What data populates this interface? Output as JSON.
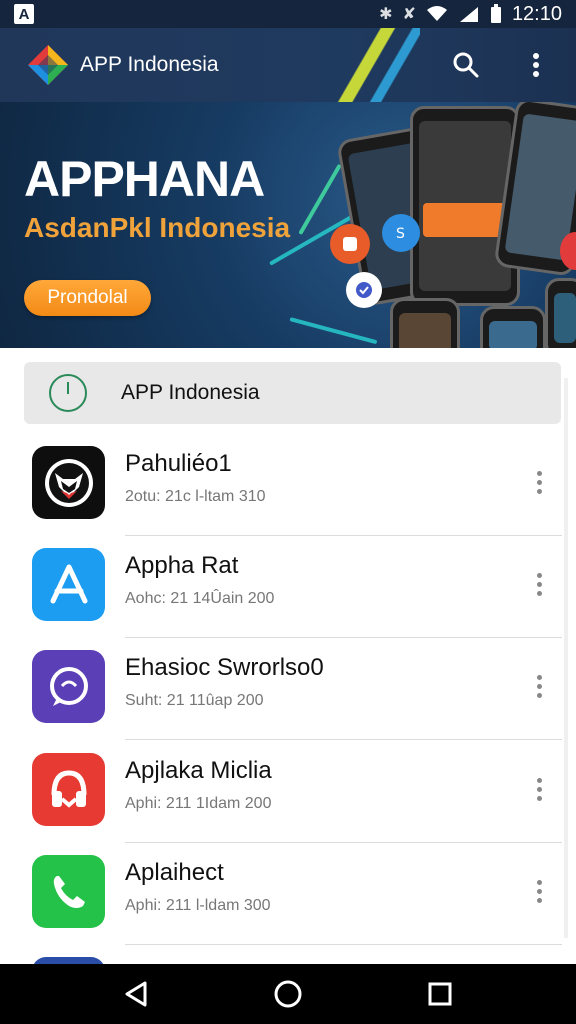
{
  "status_bar": {
    "time": "12:10",
    "icons": [
      "app-notification-icon",
      "vibrate-icon",
      "wifi-icon",
      "signal-icon",
      "battery-icon"
    ]
  },
  "app_bar": {
    "title": "APP Indonesia",
    "actions": [
      "search-icon",
      "more-vert-icon"
    ]
  },
  "banner": {
    "headline": "APPHANA",
    "subline": "AsdanPkl Indonesia",
    "button_label": "Prondolal"
  },
  "section": {
    "label": "APP Indonesia",
    "icon": "clock-icon"
  },
  "apps": [
    {
      "name": "Pahuliéo1",
      "meta": "2otu: 21c l-ltam 310",
      "icon": "bull-logo-icon",
      "color": "#0e0e0e"
    },
    {
      "name": "Appha Rat",
      "meta": "Aohc: 21 14Ûain 200",
      "icon": "app-store-icon",
      "color": "#1c9df2"
    },
    {
      "name": "Ehasioc Swrorlso0",
      "meta": "Suht: 21 11ûap 200",
      "icon": "chat-bubble-icon",
      "color": "#5a3fb6"
    },
    {
      "name": "Apjlaka Miclia",
      "meta": "Aphi: 211 1Idam 200",
      "icon": "headphones-icon",
      "color": "#e63a33"
    },
    {
      "name": "Aplaihect",
      "meta": "Aphi: 211 l-ldam 300",
      "icon": "phone-icon",
      "color": "#25c24a"
    }
  ],
  "colors": {
    "app_bar": "#20375a",
    "banner_accent": "#f0a33b",
    "button": "#f38a16"
  },
  "nav_bar": [
    "back-icon",
    "home-icon",
    "recents-icon"
  ]
}
